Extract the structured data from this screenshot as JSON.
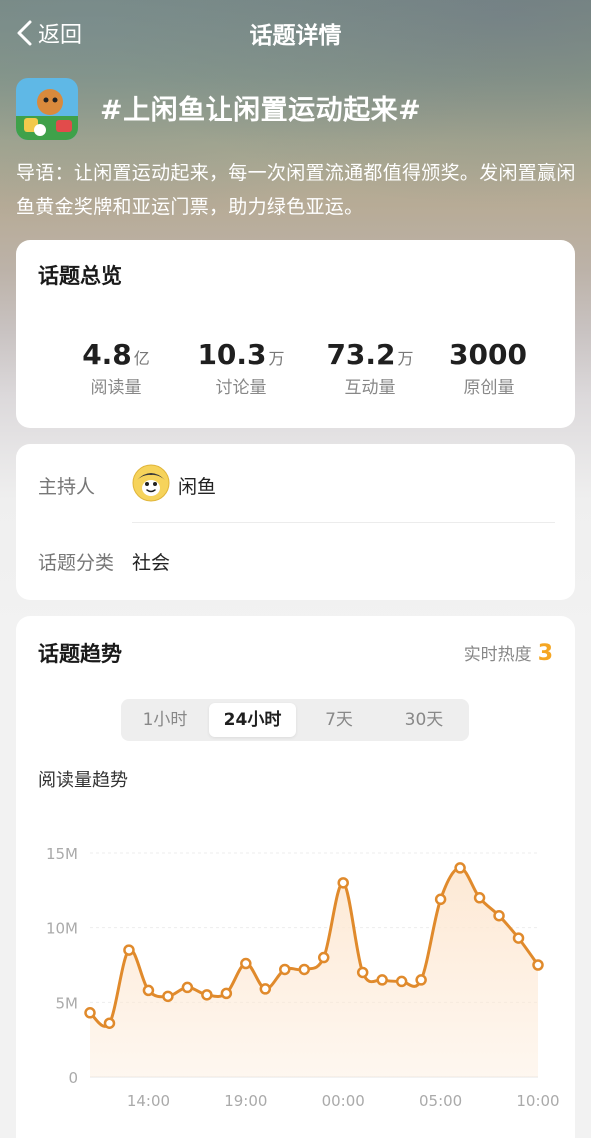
{
  "nav": {
    "back_label": "返回",
    "title": "话题详情"
  },
  "topic": {
    "title": "#上闲鱼让闲置运动起来#",
    "description": "导语：让闲置运动起来，每一次闲置流通都值得颁奖。发闲置赢闲鱼黄金奖牌和亚运门票，助力绿色亚运。"
  },
  "overview": {
    "title": "话题总览",
    "stats": [
      {
        "value": "4.8",
        "unit": "亿",
        "label": "阅读量"
      },
      {
        "value": "10.3",
        "unit": "万",
        "label": "讨论量"
      },
      {
        "value": "73.2",
        "unit": "万",
        "label": "互动量"
      },
      {
        "value": "3000",
        "unit": "",
        "label": "原创量"
      }
    ]
  },
  "info": {
    "host_label": "主持人",
    "host_name": "闲鱼",
    "category_label": "话题分类",
    "category_value": "社会"
  },
  "trend": {
    "title": "话题趋势",
    "heat_label": "实时热度",
    "heat_value": "3",
    "tabs": [
      "1小时",
      "24小时",
      "7天",
      "30天"
    ],
    "active_tab": 1,
    "chart_title": "阅读量趋势"
  },
  "colors": {
    "accent": "#f5a623",
    "line": "#e08a2c",
    "fill": "#fde8d3"
  },
  "chart_data": {
    "type": "area",
    "title": "阅读量趋势",
    "y_tick_labels": [
      "0",
      "5M",
      "10M",
      "15M"
    ],
    "y_ticks": [
      0,
      5,
      10,
      15
    ],
    "ylim": [
      0,
      15
    ],
    "y_unit": "M",
    "x_tick_labels": [
      "14:00",
      "19:00",
      "00:00",
      "05:00",
      "10:00"
    ],
    "x_tick_index": [
      3,
      8,
      13,
      18,
      23
    ],
    "series": [
      {
        "values": [
          4.3,
          3.6,
          8.5,
          5.8,
          5.4,
          6.0,
          5.5,
          5.6,
          7.6,
          5.9,
          7.2,
          7.2,
          8.0,
          13.0,
          7.0,
          6.5,
          6.4,
          6.5,
          11.9,
          14.0,
          12.0,
          10.8,
          9.3,
          7.5
        ]
      }
    ],
    "grid": true,
    "legend": "none"
  }
}
